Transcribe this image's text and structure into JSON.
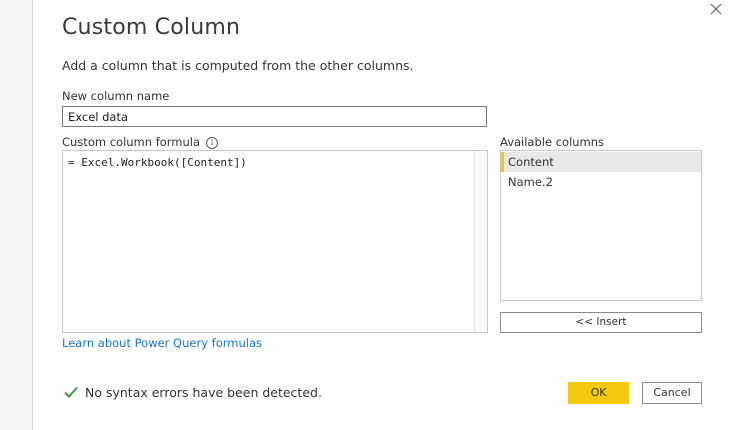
{
  "dialog": {
    "title": "Custom Column",
    "subtitle": "Add a column that is computed from the other columns.",
    "close_icon": "close-icon"
  },
  "new_column": {
    "label": "New column name",
    "value": "Excel data"
  },
  "formula": {
    "label": "Custom column formula",
    "info_icon": "info-icon",
    "info_glyph": "i",
    "value": "= Excel.Workbook([Content])"
  },
  "available_columns": {
    "label": "Available columns",
    "items": [
      {
        "label": "Content",
        "selected": true
      },
      {
        "label": "Name.2",
        "selected": false
      }
    ],
    "insert_label": "<< Insert"
  },
  "learn_link": "Learn about Power Query formulas",
  "status": {
    "icon": "check-icon",
    "text": "No syntax errors have been detected.",
    "color": "#3c9a3c"
  },
  "buttons": {
    "ok_label": "OK",
    "cancel_label": "Cancel"
  },
  "colors": {
    "accent": "#f2c811",
    "link": "#1a73c9"
  }
}
